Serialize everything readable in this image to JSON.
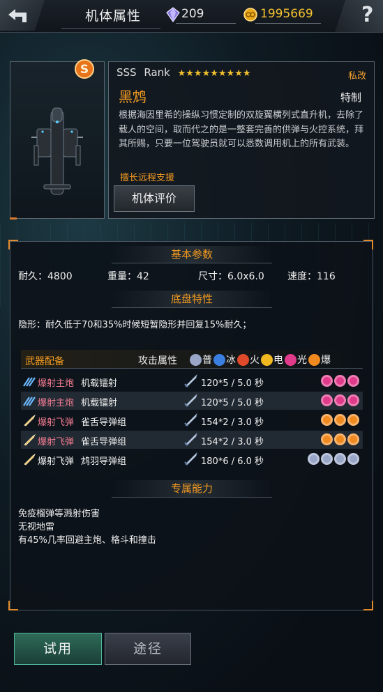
{
  "header": {
    "title": "机体属性",
    "gems": "209",
    "gold": "1995669"
  },
  "unit": {
    "rank_text": "SSS",
    "rank_word": "Rank",
    "stars": "★★★★★★★★★",
    "mod_tag": "私改",
    "name": "黑鸩",
    "special_tag": "特制",
    "description": "根据海因里希的操纵习惯定制的双旋翼横列式直升机，去除了载人的空间，取而代之的是一整套完善的供弹与火控系统，拜其所赐，只要一位驾驶员就可以悉数调用机上的所有武装。",
    "specialty": "擅长远程支援",
    "eval_button": "机体评价"
  },
  "basic": {
    "section_title": "基本参数",
    "durability": "耐久：4800",
    "weight": "重量：42",
    "size": "尺寸：6.0x6.0",
    "speed": "速度：116"
  },
  "chassis": {
    "section_title": "底盘特性",
    "trait": "隐形：耐久低于70和35%时候短暂隐形并回复15%耐久；"
  },
  "weapons": {
    "header_label": "武器配备",
    "attack_label": "攻击属性",
    "elements": [
      "普",
      "冰",
      "火",
      "电",
      "光",
      "爆"
    ],
    "element_colors": [
      "#9aa6c8",
      "#3a7ee0",
      "#e04a2a",
      "#f2b820",
      "#e03a8a",
      "#f08a20"
    ],
    "rows": [
      {
        "type": "爆射主炮",
        "name": "机载镭射",
        "damage": "120*5 / 5.0 秒",
        "icon": "laser-icon",
        "dot_color": "#e03a8a",
        "dots": 3,
        "type_color": "#f07a90"
      },
      {
        "type": "爆射主炮",
        "name": "机载镭射",
        "damage": "120*5 / 5.0 秒",
        "icon": "laser-icon",
        "dot_color": "#e03a8a",
        "dots": 3,
        "type_color": "#f07a90"
      },
      {
        "type": "爆射飞弹",
        "name": "雀舌导弹组",
        "damage": "154*2 / 3.0 秒",
        "icon": "missile-icon",
        "dot_color": "#f08a20",
        "dots": 3,
        "type_color": "#f07a90"
      },
      {
        "type": "爆射飞弹",
        "name": "雀舌导弹组",
        "damage": "154*2 / 3.0 秒",
        "icon": "missile-icon",
        "dot_color": "#f08a20",
        "dots": 3,
        "type_color": "#f07a90"
      },
      {
        "type": "爆射飞弹",
        "name": "鸩羽导弹组",
        "damage": "180*6 / 6.0 秒",
        "icon": "missile-icon",
        "dot_color": "#9aa6c8",
        "dots": 4,
        "type_color": "#f0f0f0"
      }
    ]
  },
  "exclusive": {
    "section_title": "专属能力",
    "lines": [
      "免疫榴弹等溅射伤害",
      "无视地雷",
      "有45%几率回避主炮、格斗和撞击"
    ]
  },
  "buttons": {
    "try": "试用",
    "route": "途径"
  }
}
